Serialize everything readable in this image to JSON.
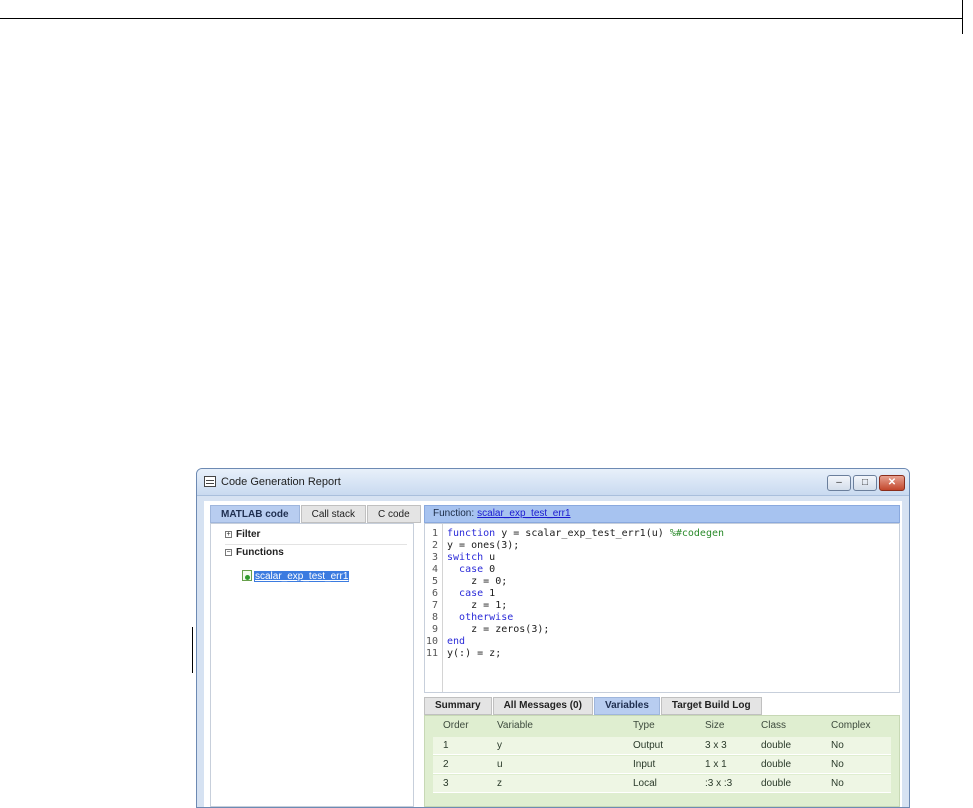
{
  "window": {
    "title": "Code Generation Report",
    "controls": {
      "minimize": "–",
      "maximize": "□",
      "close": "✕"
    }
  },
  "left_tabs": [
    "MATLAB code",
    "Call stack",
    "C code"
  ],
  "tree": {
    "filter_label": "Filter",
    "functions_label": "Functions",
    "function_item": "scalar_exp_test_err1"
  },
  "function_header": {
    "prefix": "Function:",
    "name": "scalar_exp_test_err1"
  },
  "code_lines": [
    {
      "n": "1",
      "code": "function y = scalar_exp_test_err1(u) %#codegen"
    },
    {
      "n": "2",
      "code": "y = ones(3);"
    },
    {
      "n": "3",
      "code": "switch u"
    },
    {
      "n": "4",
      "code": "  case 0"
    },
    {
      "n": "5",
      "code": "    z = 0;"
    },
    {
      "n": "6",
      "code": "  case 1"
    },
    {
      "n": "7",
      "code": "    z = 1;"
    },
    {
      "n": "8",
      "code": "  otherwise"
    },
    {
      "n": "9",
      "code": "    z = zeros(3);"
    },
    {
      "n": "10",
      "code": "end"
    },
    {
      "n": "11",
      "code": "y(:) = z;"
    }
  ],
  "bottom_tabs": [
    "Summary",
    "All Messages (0)",
    "Variables",
    "Target Build Log"
  ],
  "variables_table": {
    "columns": [
      "Order",
      "Variable",
      "Type",
      "Size",
      "Class",
      "Complex"
    ],
    "rows": [
      [
        "1",
        "y",
        "Output",
        "3 x 3",
        "double",
        "No"
      ],
      [
        "2",
        "u",
        "Input",
        "1 x 1",
        "double",
        "No"
      ],
      [
        "3",
        "z",
        "Local",
        ":3 x :3",
        "double",
        "No"
      ]
    ]
  },
  "colors": {
    "active_tab": "#b8cdf0",
    "header_blue": "#a7c3f0",
    "table_green": "#dfeed0",
    "keyword": "#2b2bd8",
    "comment": "#2a8a2a"
  }
}
